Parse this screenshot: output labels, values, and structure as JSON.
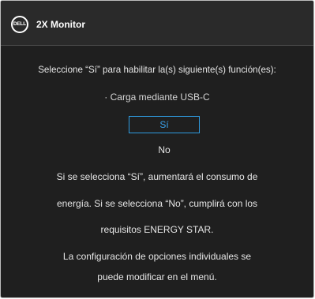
{
  "header": {
    "logo_text": "DELL",
    "title": "2X Monitor"
  },
  "dialog": {
    "question": "Seleccione “Sí” para habilitar la(s) siguiente(s) función(es):",
    "feature": "· Carga mediante USB-C",
    "yes_label": "Sí",
    "no_label": "No",
    "info_lines": [
      "Si se selecciona “Sí”, aumentará el consumo de",
      "energía. Si se selecciona “No”, cumplirá con los",
      "requisitos ENERGY STAR.",
      "La configuración de opciones individuales se",
      "puede modificar en el menú."
    ]
  },
  "colors": {
    "background": "#1f1f1f",
    "header_background": "#2a2a2a",
    "selected_accent": "#2f9be0",
    "text": "#e6e6e6"
  }
}
